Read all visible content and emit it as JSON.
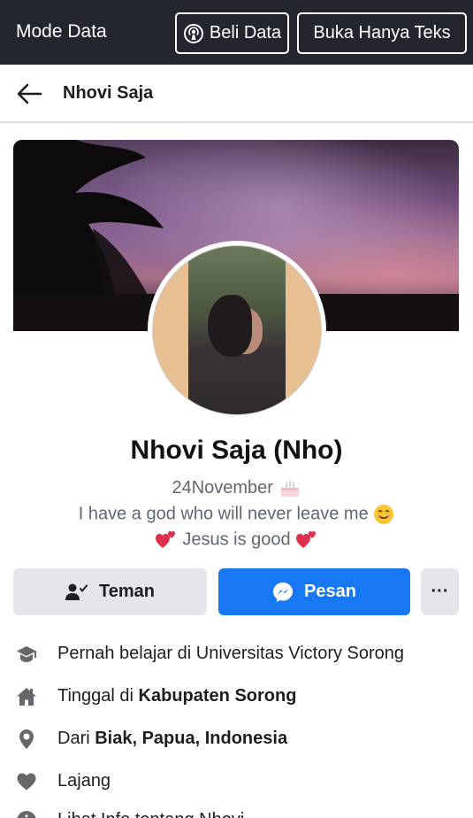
{
  "top_bar": {
    "mode_label": "Mode Data",
    "buy_data_label": "Beli Data",
    "text_only_label": "Buka Hanya Teks"
  },
  "header": {
    "title": "Nhovi Saja"
  },
  "profile": {
    "name": "Nhovi Saja (Nho)",
    "bio_line1": "24November",
    "bio_line2": "I have a god who will never leave me",
    "bio_line3": "Jesus is good"
  },
  "actions": {
    "friends_label": "Teman",
    "message_label": "Pesan",
    "more_label": "···"
  },
  "info": {
    "education": "Pernah belajar di Universitas Victory Sorong",
    "lives_prefix": "Tinggal di ",
    "lives_value": "Kabupaten Sorong",
    "from_prefix": "Dari ",
    "from_value": "Biak, Papua, Indonesia",
    "relationship": "Lajang",
    "more_about": "Lihat Info tentang Nhovi"
  },
  "colors": {
    "top_bar_bg": "#23272d",
    "primary_blue": "#1877f2",
    "secondary_gray": "#e4e6eb",
    "muted_text": "#606770"
  },
  "icons": {
    "broadcast": "broadcast-icon",
    "back": "back-arrow-icon",
    "friend": "friend-check-icon",
    "messenger": "messenger-icon",
    "education": "graduation-cap-icon",
    "home": "home-icon",
    "location": "location-pin-icon",
    "heart": "heart-icon",
    "info": "info-icon"
  }
}
